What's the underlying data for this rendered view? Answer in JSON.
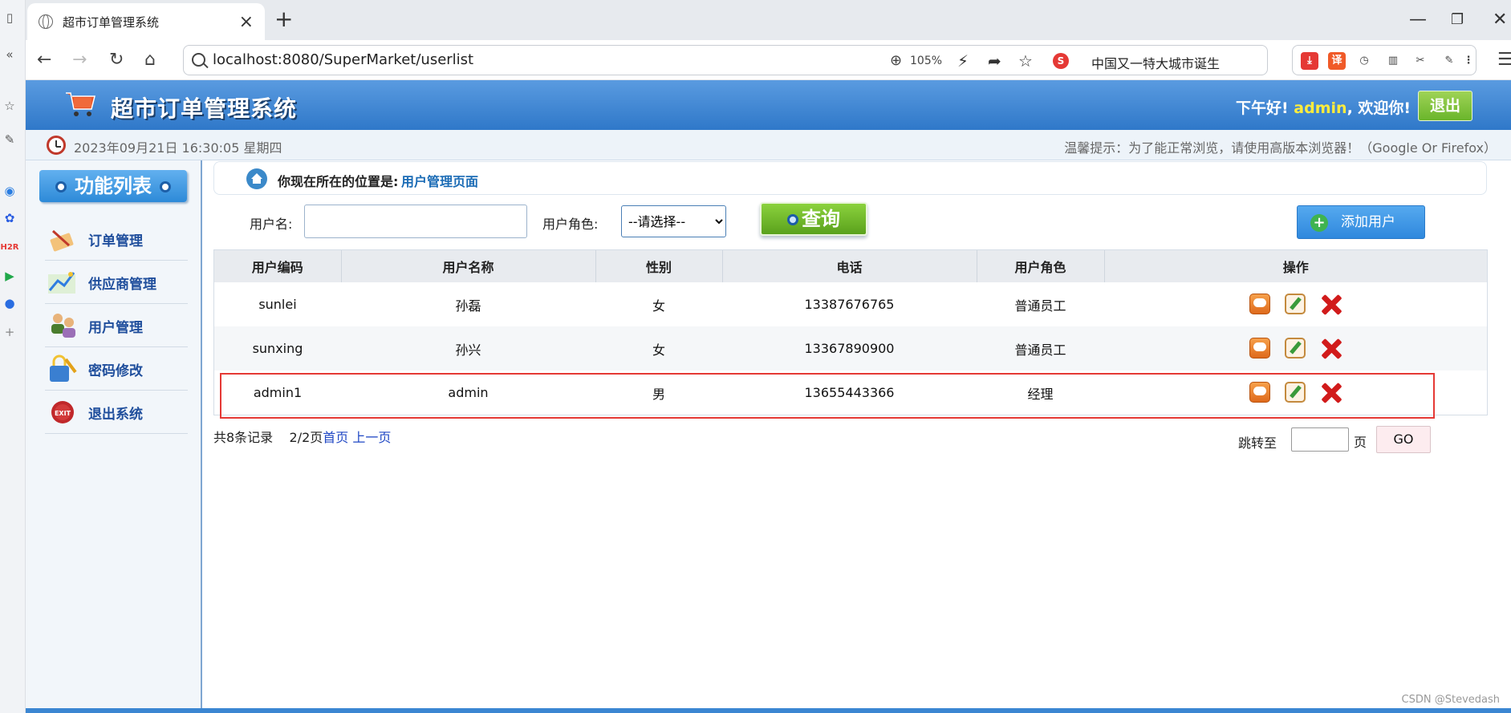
{
  "browser": {
    "tab_title": "超市订单管理系统",
    "url": "localhost:8080/SuperMarket/userlist",
    "zoom": "105%",
    "news_text": "中国又一特大城市诞生",
    "ext_translate": "译"
  },
  "header": {
    "title": "超市订单管理系统",
    "greeting_prefix": "下午好!",
    "username": "admin",
    "greeting_suffix": ", 欢迎你!",
    "logout_label": "退出"
  },
  "infobar": {
    "datetime": "2023年09月21日 16:30:05 星期四",
    "tip": "温馨提示：为了能正常浏览，请使用高版本浏览器！（Google Or Firefox）"
  },
  "sidebar": {
    "title": "功能列表",
    "items": [
      {
        "label": "订单管理",
        "icon": "order-icon"
      },
      {
        "label": "供应商管理",
        "icon": "provider-icon"
      },
      {
        "label": "用户管理",
        "icon": "users-icon"
      },
      {
        "label": "密码修改",
        "icon": "password-icon"
      },
      {
        "label": "退出系统",
        "icon": "exit-icon"
      }
    ]
  },
  "breadcrumb": {
    "prefix": "你现在所在的位置是:",
    "current": "用户管理页面"
  },
  "search": {
    "username_label": "用户名:",
    "username_value": "",
    "role_label": "用户角色:",
    "role_selected": "--请选择--",
    "query_label": "查询",
    "add_label": "添加用户"
  },
  "table": {
    "headers": [
      "用户编码",
      "用户名称",
      "性别",
      "电话",
      "用户角色",
      "操作"
    ],
    "rows": [
      {
        "code": "sunlei",
        "name": "孙磊",
        "gender": "女",
        "phone": "13387676765",
        "role": "普通员工"
      },
      {
        "code": "sunxing",
        "name": "孙兴",
        "gender": "女",
        "phone": "13367890900",
        "role": "普通员工"
      },
      {
        "code": "admin1",
        "name": "admin",
        "gender": "男",
        "phone": "13655443366",
        "role": "经理"
      }
    ]
  },
  "pagination": {
    "records": "共8条记录",
    "pages": "2/2页",
    "first": "首页",
    "prev": "上一页",
    "jump_label": "跳转至",
    "page_unit": "页",
    "go_label": "GO"
  },
  "watermark": "CSDN @Stevedash",
  "colors": {
    "header_blue": "#2f78c9",
    "accent_green": "#6ab52b",
    "link_blue": "#1f4e9c",
    "highlight_red": "#e53935"
  }
}
